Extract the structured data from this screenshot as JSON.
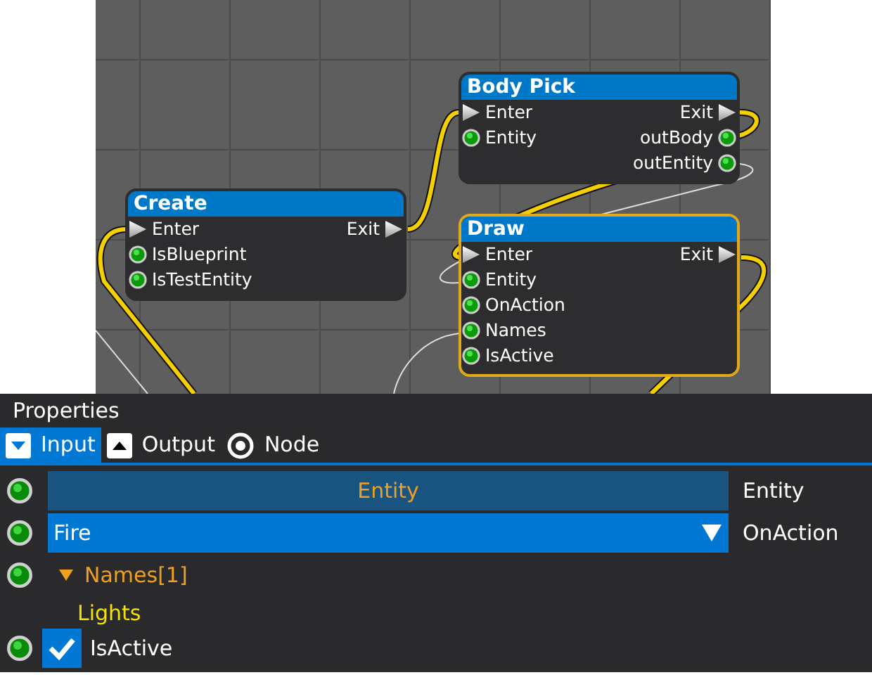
{
  "graph": {
    "nodes": [
      {
        "title": "Body Pick",
        "selected": false,
        "inputs": [
          {
            "label": "Enter",
            "kind": "flow"
          },
          {
            "label": "Entity",
            "kind": "data"
          }
        ],
        "outputs": [
          {
            "label": "Exit",
            "kind": "flow"
          },
          {
            "label": "outBody",
            "kind": "data"
          },
          {
            "label": "outEntity",
            "kind": "data"
          }
        ]
      },
      {
        "title": "Create",
        "selected": false,
        "inputs": [
          {
            "label": "Enter",
            "kind": "flow"
          },
          {
            "label": "IsBlueprint",
            "kind": "data"
          },
          {
            "label": "IsTestEntity",
            "kind": "data"
          }
        ],
        "outputs": [
          {
            "label": "Exit",
            "kind": "flow"
          }
        ]
      },
      {
        "title": "Draw",
        "selected": true,
        "inputs": [
          {
            "label": "Enter",
            "kind": "flow"
          },
          {
            "label": "Entity",
            "kind": "data"
          },
          {
            "label": "OnAction",
            "kind": "data"
          },
          {
            "label": "Names",
            "kind": "data"
          },
          {
            "label": "IsActive",
            "kind": "data"
          }
        ],
        "outputs": [
          {
            "label": "Exit",
            "kind": "flow"
          }
        ]
      }
    ]
  },
  "properties": {
    "title": "Properties",
    "tabs": [
      {
        "label": "Input",
        "selected": true,
        "kind": "down"
      },
      {
        "label": "Output",
        "selected": false,
        "kind": "up"
      },
      {
        "label": "Node",
        "selected": false,
        "kind": "target"
      }
    ],
    "rows": [
      {
        "kind": "entity",
        "label": "Entity",
        "value": "Entity"
      },
      {
        "kind": "dropdown",
        "label": "OnAction",
        "value": "Fire"
      },
      {
        "kind": "list",
        "name": "Names[1]",
        "expanded": true,
        "items": [
          "Lights"
        ]
      },
      {
        "kind": "checkbox",
        "label": "IsActive",
        "checked": true
      }
    ]
  }
}
